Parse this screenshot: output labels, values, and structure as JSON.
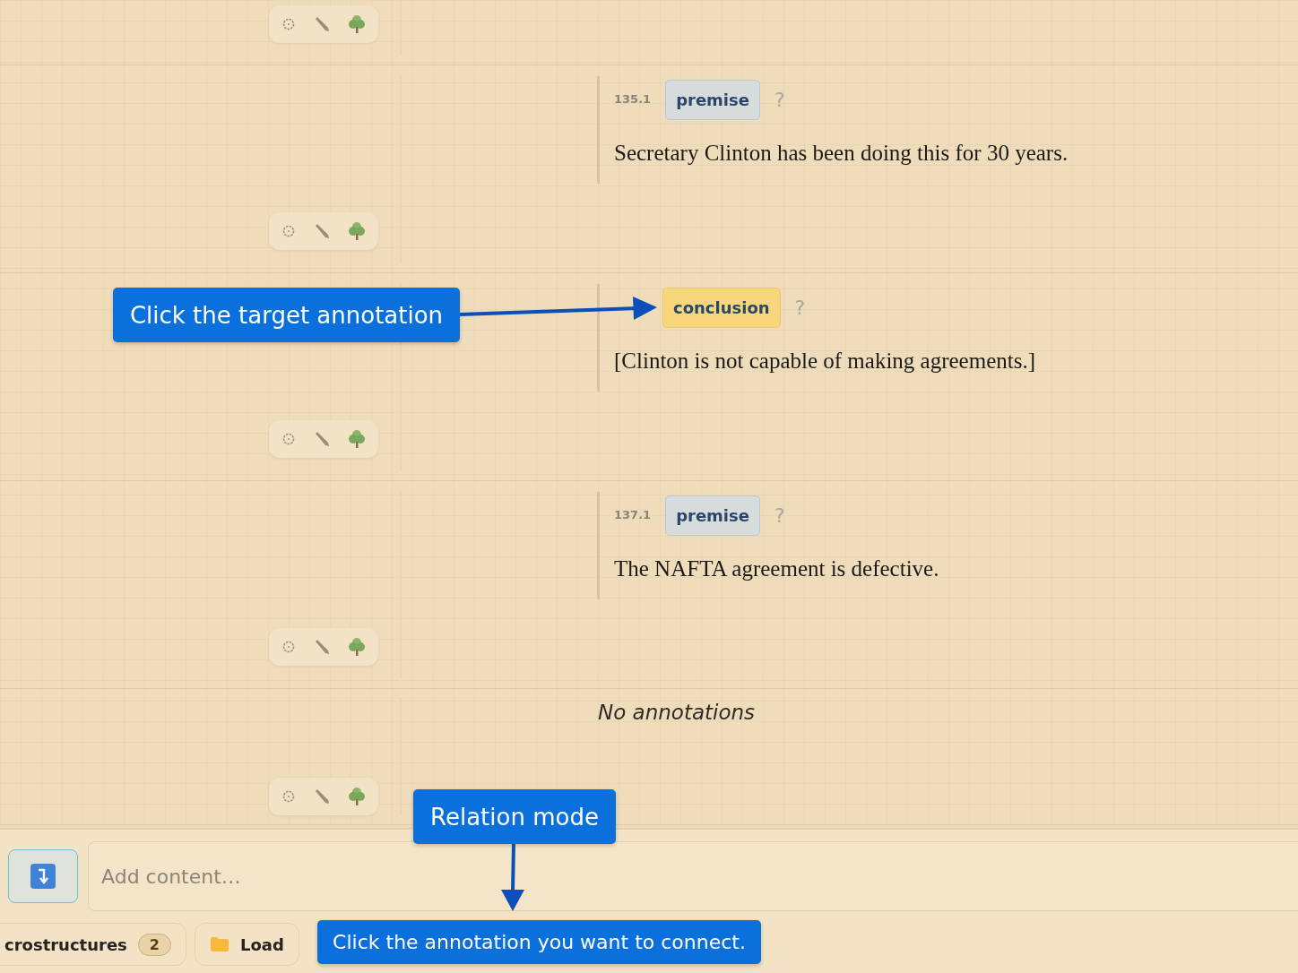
{
  "rows": [
    {
      "kind": "cut"
    },
    {
      "kind": "annotation",
      "number": "135.1",
      "label": {
        "text": "premise",
        "kind": "premise"
      },
      "help": "?",
      "text": "Secretary Clinton has been doing this for 30 years."
    },
    {
      "kind": "annotation",
      "label": {
        "text": "conclusion",
        "kind": "conclusion"
      },
      "help": "?",
      "text": "[Clinton is not capable of making agreements.]"
    },
    {
      "kind": "annotation",
      "number": "137.1",
      "label": {
        "text": "premise",
        "kind": "premise"
      },
      "help": "?",
      "text": "The NAFTA agreement is defective."
    },
    {
      "kind": "empty",
      "text": "No annotations"
    }
  ],
  "composer": {
    "relation_button": {
      "selected": true
    },
    "placeholder": "Add content…"
  },
  "bottom_bar": [
    {
      "label": "crostructures",
      "count": "2",
      "kind": "count"
    },
    {
      "label": "Load",
      "kind": "folder"
    }
  ],
  "callouts": [
    {
      "kind": "target",
      "text": "Click the target annotation"
    },
    {
      "kind": "mode",
      "text": "Relation mode"
    },
    {
      "kind": "hint",
      "text": "Click the annotation you want to connect."
    }
  ]
}
